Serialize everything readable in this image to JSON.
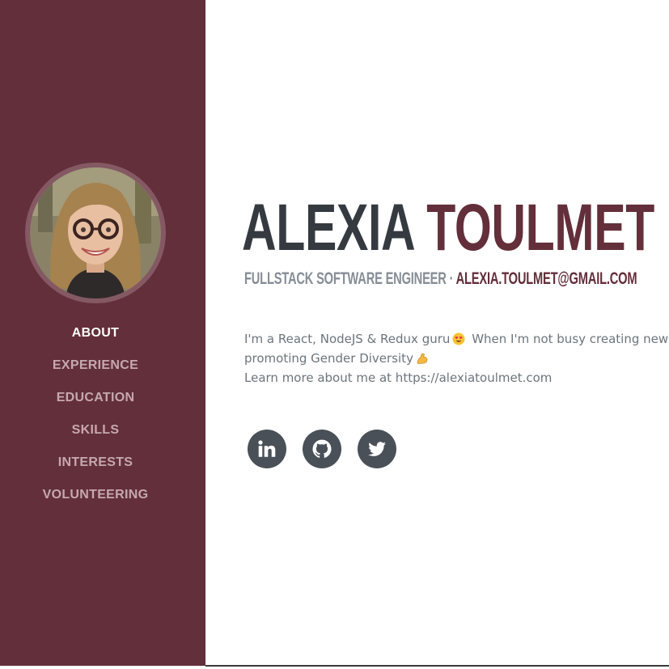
{
  "profile": {
    "first_name": "ALEXIA",
    "last_name": "TOULMET",
    "title": "FULLSTACK SOFTWARE ENGINEER",
    "separator": "·",
    "email": "ALEXIA.TOULMET@GMAIL.COM"
  },
  "nav": {
    "active": "ABOUT",
    "items": [
      "ABOUT",
      "EXPERIENCE",
      "EDUCATION",
      "SKILLS",
      "INTERESTS",
      "VOLUNTEERING"
    ]
  },
  "bio": {
    "line1": "I'm a React, NodeJS & Redux guru",
    "line1_after": "When I'm not busy creating new R",
    "line2": "promoting Gender Diversity",
    "line3": "Learn more about me at https://alexiatoulmet.com"
  },
  "icons": {
    "emoji_1": "heart-eyes-emoji",
    "emoji_2": "flexed-biceps-emoji",
    "social": [
      "linkedin-icon",
      "github-icon",
      "twitter-icon"
    ]
  },
  "colors": {
    "sidebar_bg": "#632f3a",
    "accent": "#632f3a",
    "heading_dark": "#343a40",
    "muted_text": "#868e96",
    "nav_inactive": "#c5a9ae",
    "nav_active": "#ffffff",
    "social_bg": "#495057"
  }
}
